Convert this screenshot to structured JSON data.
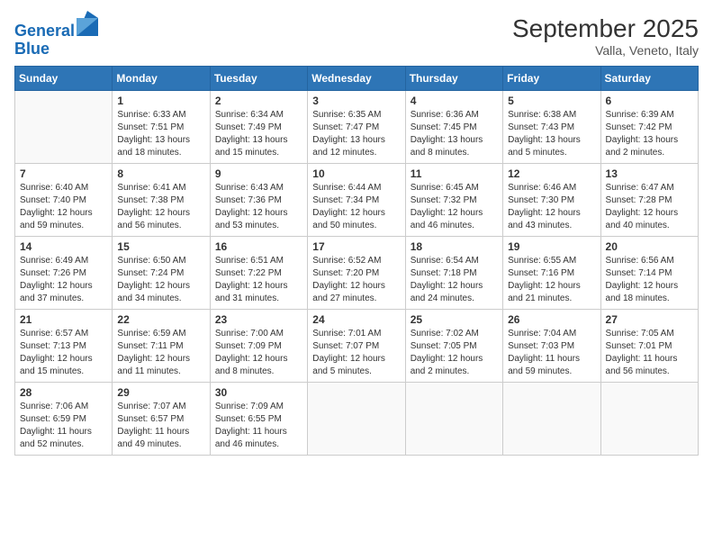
{
  "logo": {
    "text_general": "General",
    "text_blue": "Blue"
  },
  "header": {
    "title": "September 2025",
    "subtitle": "Valla, Veneto, Italy"
  },
  "days": [
    "Sunday",
    "Monday",
    "Tuesday",
    "Wednesday",
    "Thursday",
    "Friday",
    "Saturday"
  ],
  "weeks": [
    [
      {
        "day": "",
        "content": ""
      },
      {
        "day": "1",
        "content": "Sunrise: 6:33 AM\nSunset: 7:51 PM\nDaylight: 13 hours\nand 18 minutes."
      },
      {
        "day": "2",
        "content": "Sunrise: 6:34 AM\nSunset: 7:49 PM\nDaylight: 13 hours\nand 15 minutes."
      },
      {
        "day": "3",
        "content": "Sunrise: 6:35 AM\nSunset: 7:47 PM\nDaylight: 13 hours\nand 12 minutes."
      },
      {
        "day": "4",
        "content": "Sunrise: 6:36 AM\nSunset: 7:45 PM\nDaylight: 13 hours\nand 8 minutes."
      },
      {
        "day": "5",
        "content": "Sunrise: 6:38 AM\nSunset: 7:43 PM\nDaylight: 13 hours\nand 5 minutes."
      },
      {
        "day": "6",
        "content": "Sunrise: 6:39 AM\nSunset: 7:42 PM\nDaylight: 13 hours\nand 2 minutes."
      }
    ],
    [
      {
        "day": "7",
        "content": "Sunrise: 6:40 AM\nSunset: 7:40 PM\nDaylight: 12 hours\nand 59 minutes."
      },
      {
        "day": "8",
        "content": "Sunrise: 6:41 AM\nSunset: 7:38 PM\nDaylight: 12 hours\nand 56 minutes."
      },
      {
        "day": "9",
        "content": "Sunrise: 6:43 AM\nSunset: 7:36 PM\nDaylight: 12 hours\nand 53 minutes."
      },
      {
        "day": "10",
        "content": "Sunrise: 6:44 AM\nSunset: 7:34 PM\nDaylight: 12 hours\nand 50 minutes."
      },
      {
        "day": "11",
        "content": "Sunrise: 6:45 AM\nSunset: 7:32 PM\nDaylight: 12 hours\nand 46 minutes."
      },
      {
        "day": "12",
        "content": "Sunrise: 6:46 AM\nSunset: 7:30 PM\nDaylight: 12 hours\nand 43 minutes."
      },
      {
        "day": "13",
        "content": "Sunrise: 6:47 AM\nSunset: 7:28 PM\nDaylight: 12 hours\nand 40 minutes."
      }
    ],
    [
      {
        "day": "14",
        "content": "Sunrise: 6:49 AM\nSunset: 7:26 PM\nDaylight: 12 hours\nand 37 minutes."
      },
      {
        "day": "15",
        "content": "Sunrise: 6:50 AM\nSunset: 7:24 PM\nDaylight: 12 hours\nand 34 minutes."
      },
      {
        "day": "16",
        "content": "Sunrise: 6:51 AM\nSunset: 7:22 PM\nDaylight: 12 hours\nand 31 minutes."
      },
      {
        "day": "17",
        "content": "Sunrise: 6:52 AM\nSunset: 7:20 PM\nDaylight: 12 hours\nand 27 minutes."
      },
      {
        "day": "18",
        "content": "Sunrise: 6:54 AM\nSunset: 7:18 PM\nDaylight: 12 hours\nand 24 minutes."
      },
      {
        "day": "19",
        "content": "Sunrise: 6:55 AM\nSunset: 7:16 PM\nDaylight: 12 hours\nand 21 minutes."
      },
      {
        "day": "20",
        "content": "Sunrise: 6:56 AM\nSunset: 7:14 PM\nDaylight: 12 hours\nand 18 minutes."
      }
    ],
    [
      {
        "day": "21",
        "content": "Sunrise: 6:57 AM\nSunset: 7:13 PM\nDaylight: 12 hours\nand 15 minutes."
      },
      {
        "day": "22",
        "content": "Sunrise: 6:59 AM\nSunset: 7:11 PM\nDaylight: 12 hours\nand 11 minutes."
      },
      {
        "day": "23",
        "content": "Sunrise: 7:00 AM\nSunset: 7:09 PM\nDaylight: 12 hours\nand 8 minutes."
      },
      {
        "day": "24",
        "content": "Sunrise: 7:01 AM\nSunset: 7:07 PM\nDaylight: 12 hours\nand 5 minutes."
      },
      {
        "day": "25",
        "content": "Sunrise: 7:02 AM\nSunset: 7:05 PM\nDaylight: 12 hours\nand 2 minutes."
      },
      {
        "day": "26",
        "content": "Sunrise: 7:04 AM\nSunset: 7:03 PM\nDaylight: 11 hours\nand 59 minutes."
      },
      {
        "day": "27",
        "content": "Sunrise: 7:05 AM\nSunset: 7:01 PM\nDaylight: 11 hours\nand 56 minutes."
      }
    ],
    [
      {
        "day": "28",
        "content": "Sunrise: 7:06 AM\nSunset: 6:59 PM\nDaylight: 11 hours\nand 52 minutes."
      },
      {
        "day": "29",
        "content": "Sunrise: 7:07 AM\nSunset: 6:57 PM\nDaylight: 11 hours\nand 49 minutes."
      },
      {
        "day": "30",
        "content": "Sunrise: 7:09 AM\nSunset: 6:55 PM\nDaylight: 11 hours\nand 46 minutes."
      },
      {
        "day": "",
        "content": ""
      },
      {
        "day": "",
        "content": ""
      },
      {
        "day": "",
        "content": ""
      },
      {
        "day": "",
        "content": ""
      }
    ]
  ]
}
